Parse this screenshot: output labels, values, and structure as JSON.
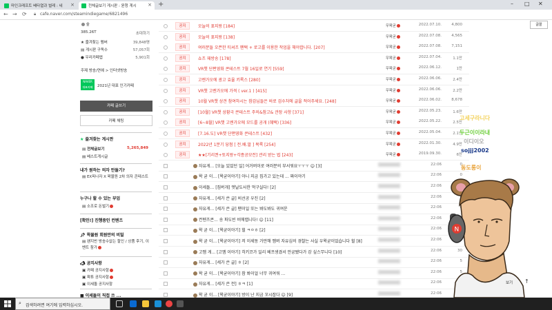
{
  "browser": {
    "tabs": [
      {
        "label": "마인크래프트 베타열과 벌레 : 네"
      },
      {
        "label": "전체글보기 게시판 : 윤청 게시"
      }
    ],
    "url": "cafe.naver.com/steamindiegame/6821496"
  },
  "sidebar": {
    "stats": [
      {
        "label": "385.26T",
        "value": "초대하기"
      },
      {
        "label": "즐겨찾는 멤버",
        "value": "39,848명"
      },
      {
        "label": "게시판 구독수",
        "value": "57,057회"
      },
      {
        "label": "우리카페앱",
        "value": "5,901회"
      }
    ],
    "rank": "주제 방송/연예 > 인터넷방송",
    "award": "2021년 대표 인기카페",
    "write_button": "카페 글쓰기",
    "chat_button": "카페 채팅",
    "fav_header": "즐겨찾는 게시판",
    "all_posts": "전체글보기",
    "all_posts_count": "5,265,849",
    "best": "베스트게시글",
    "section1": "내가 원하는 의자 만들기?",
    "section1_item": "EX피나자 X 왁물원 2차 의자 콘테스트",
    "section2": "누구나 할 수 있는 부업",
    "section2_item": "소조로 돈벌기",
    "section3": "[확인!] 진행중인 컨텐츠",
    "section4": "왁물원 회원만의 비밀",
    "section4_item": "왠지반 방송수없는 할인 / 상품 후기, 이벤트 참가",
    "section5": "공지사항",
    "notice_items": [
      "카페 공지사항",
      "왁튜 공지사항",
      "이세돌 공지사항"
    ],
    "section6": "■ 이세돌이 직접 쓰 ..."
  },
  "rows": [
    {
      "type": "notice",
      "title": "오늘의 표지왕 [184]",
      "author": "우왁굳",
      "date": "2022.07.10.",
      "views": "4,800"
    },
    {
      "type": "notice",
      "title": "오늘의 표지왕 [138]",
      "author": "우왁굳",
      "date": "2022.07.08.",
      "views": "4,565"
    },
    {
      "type": "notice",
      "title": "여러분들 오픈한 티셔츠 팬택 + 로고를 이용한 작업을 해야합니다. [207]",
      "author": "우왁굳",
      "date": "2022.07.08.",
      "views": "7,151"
    },
    {
      "type": "notice",
      "title": "쇼츠 재방송 [178]",
      "author": "우왁굳",
      "date": "2022.07.04.",
      "views": "1.1만"
    },
    {
      "type": "notice",
      "title": "VR챗 단편영화 콘테스트 7월 16일로 연기 [559]",
      "author": "우왁굳",
      "date": "2022.06.12.",
      "views": "1만"
    },
    {
      "type": "notice",
      "title": "고렌가오에 광고 효율 키록스 [280]",
      "author": "우왁굳",
      "date": "2022.06.06.",
      "views": "2.4만"
    },
    {
      "type": "notice",
      "title": "VR챗 고렌가오에 가격 ( ver.1 ) [415]",
      "author": "우왁굳",
      "date": "2022.06.06.",
      "views": "2.2만"
    },
    {
      "type": "notice",
      "title": "10월 VR챗 상견 참여하시는 참감님들은 바로 검수처에 글을 적어주세요. [248]",
      "author": "우왁굳",
      "date": "2022.06.02.",
      "views": "8,678"
    },
    {
      "type": "notice",
      "title": "[10월] VR챗 상황극 콘테스트 주의&참고& 관장 사항 [371]",
      "author": "우왁굳",
      "date": "2022.05.23.",
      "views": "1.6만"
    },
    {
      "type": "notice",
      "title": "[6~8월] VR챗 고렌가오에 모드를 공개 (혜택) [336]",
      "author": "우왁굳",
      "date": "2022.05.22.",
      "views": "2.5만"
    },
    {
      "type": "notice",
      "title": "[7.16.도] VR챗 단편영화 콘테스트 [432]",
      "author": "우왁굳",
      "date": "2022.05.04.",
      "views": "2.1만"
    },
    {
      "type": "notice",
      "title": "2022년 1분기 당첨 [ 전.배.말 ] 목록 [254]",
      "author": "우왁굳",
      "date": "2022.01.30.",
      "views": "4.9만"
    },
    {
      "type": "notice",
      "title": "★★[기리권+토지왕+각종공모전] 관리 받는 법 [243]",
      "author": "우왁굳",
      "date": "2019.09.30.",
      "views": "6만"
    },
    {
      "type": "post",
      "title": "자유게... [오늘 있었던 일] 어거버이로 여러분의 부서워요ㅜㅜㅜ ☺ [3]",
      "date": "22:06",
      "views": "0"
    },
    {
      "type": "post",
      "title": "왁 굳 이... [왁굳이야기] 아니 지금 집가고 있는데 ... 짜이야기",
      "date": "22:06",
      "views": "0"
    },
    {
      "type": "post",
      "title": "이세돌... [집버개] 엣날도사한 먹구실다! [2]",
      "date": "22:06",
      "views": "0"
    },
    {
      "type": "post",
      "title": "자유게... [세가 쓴 글] 비선공 우진 [2]",
      "date": "22:06",
      "views": "0"
    },
    {
      "type": "post",
      "title": "자유게... [세가 쓴 글] 팬이일 또는 봐도봐도 귀여운",
      "date": "22:06",
      "views": "0"
    },
    {
      "type": "post",
      "title": "컨텐츠콘... 송 파도빈 비에랩니다! ☺ [11]",
      "date": "22:06",
      "views": "0"
    },
    {
      "type": "post",
      "title": "왁 굳 이... [왁굳이야기] 헐 ㅋㅇㅎ [2]",
      "date": "22:06",
      "views": "0"
    },
    {
      "type": "post",
      "title": "왁 굳 이... [왁굳이야기] 저 이세동 가만해 멤버 자유심의 경찰는 사실 우왁굳이었습니다 헐 [8]",
      "date": "22:06",
      "views": "0"
    },
    {
      "type": "post",
      "title": "고멤 게... [고멤 이야기] 히키코가 일리 베프생겼서 안궁됐다가 강 싶스무니다 [10]",
      "date": "22:06",
      "views": "30"
    },
    {
      "type": "post",
      "title": "자유게... [세가 쓴 글] ㅎ [2]",
      "date": "22:06",
      "views": "5"
    },
    {
      "type": "post",
      "title": "왁 굳 이... [왁굳이야기] 참 봐이얼 너무 귀여워 ...",
      "date": "22:06",
      "views": "5"
    },
    {
      "type": "post",
      "title": "자유게... [세가 쓴 전] ㅎㅋ [1]",
      "date": "22:06",
      "views": "6"
    },
    {
      "type": "post",
      "title": "왁 굳 이... [왁굳이야기] 방이 난 지금 꼬시잡다 ☺ [9]",
      "date": "22:06",
      "views": "5"
    }
  ],
  "font_button": "글꼴",
  "stream_overlay": {
    "chat_names": [
      {
        "name": "고세구라니다",
        "color": "#f4d35e"
      },
      {
        "name": "두근이이라내",
        "color": "#6fcf3c"
      },
      {
        "name": "이디이오",
        "color": "#aaaaaa"
      },
      {
        "name": "sojjj2002",
        "color": "#1a3a8a"
      },
      {
        "name": "동도롱이",
        "color": "#e8a33a"
      }
    ],
    "more_label": "보기"
  },
  "taskbar": {
    "search_placeholder": "검색하려면 여기에 입력하십시오."
  }
}
